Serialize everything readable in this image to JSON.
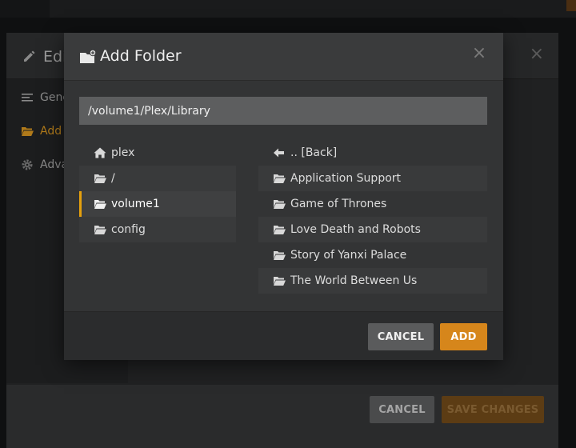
{
  "background": {
    "title": "Edi",
    "sidebar": [
      {
        "label": "Gene",
        "icon": "list-icon",
        "active": false
      },
      {
        "label": "Add f",
        "icon": "folder-open-icon",
        "active": true
      },
      {
        "label": "Adva",
        "icon": "gear-icon",
        "active": false
      }
    ],
    "cancel_label": "CANCEL",
    "save_label": "SAVE CHANGES",
    "close_glyph": "×"
  },
  "dialog": {
    "title": "Add Folder",
    "close_glyph": "×",
    "path_value": "/volume1/Plex/Library",
    "left_items": [
      {
        "label": "plex",
        "icon": "home-icon"
      },
      {
        "label": "/",
        "icon": "folder-open-icon"
      },
      {
        "label": "volume1",
        "icon": "folder-open-icon",
        "selected": true
      },
      {
        "label": "config",
        "icon": "folder-open-icon"
      }
    ],
    "right_items": [
      {
        "label": ".. [Back]",
        "icon": "arrow-left-icon"
      },
      {
        "label": "Application Support",
        "icon": "folder-open-icon"
      },
      {
        "label": "Game of Thrones",
        "icon": "folder-open-icon"
      },
      {
        "label": "Love Death and Robots",
        "icon": "folder-open-icon"
      },
      {
        "label": "Story of Yanxi Palace",
        "icon": "folder-open-icon"
      },
      {
        "label": "The World Between Us",
        "icon": "folder-open-icon"
      }
    ],
    "cancel_label": "CANCEL",
    "add_label": "ADD"
  },
  "colors": {
    "accent": "#e5a00d",
    "add_button": "#d6861b",
    "dialog_bg": "#333435"
  }
}
